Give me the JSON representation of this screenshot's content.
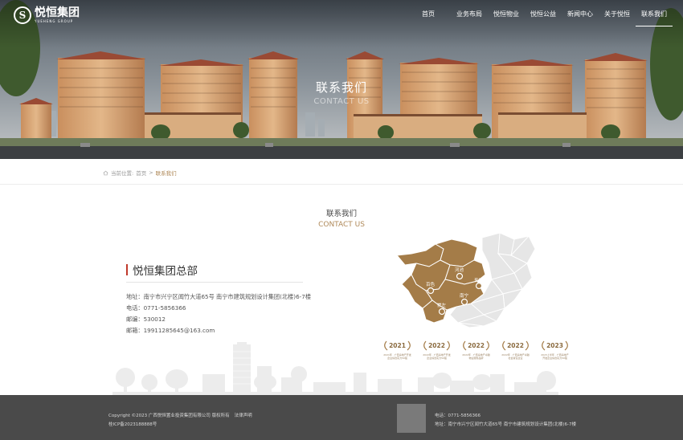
{
  "brand": {
    "logo_mark": "S",
    "name": "悦恒集团",
    "tagline": "YUEHENG GROUP"
  },
  "nav": {
    "items": [
      {
        "label": "首页"
      },
      {
        "label": "业务布局"
      },
      {
        "label": "悦恒物业"
      },
      {
        "label": "悦恒公益"
      },
      {
        "label": "新闻中心"
      },
      {
        "label": "关于悦恒"
      },
      {
        "label": "联系我们",
        "active": true
      }
    ]
  },
  "hero": {
    "title": "联系我们",
    "subtitle": "CONTACT US"
  },
  "breadcrumb": {
    "icon": "home-icon",
    "prefix": "当前位置:",
    "home": "首页",
    "separator": ">",
    "current": "联系我们"
  },
  "section": {
    "title": "联系我们",
    "subtitle": "CONTACT US"
  },
  "headquarters": {
    "title": "悦恒集团总部",
    "address": "地址：南宁市兴宁区闻竹大道65号 南宁市建筑规划设计集团(北楼)6-7楼",
    "phone": "电话：0771-5856366",
    "postcode": "邮编：530012",
    "email": "邮箱：19911285645@163.com"
  },
  "map": {
    "region_color": "#a47c48",
    "other_color": "#e8e8e8",
    "cities": [
      {
        "name": "河池"
      },
      {
        "name": "来宾"
      },
      {
        "name": "百色"
      },
      {
        "name": "南宁"
      },
      {
        "name": "崇左"
      }
    ]
  },
  "awards": [
    {
      "year": "2021",
      "text": "2021年 · 广西房地产开发企业综合实力50强"
    },
    {
      "year": "2022",
      "text": "2022年 · 广西房地产开发企业综合实力50强"
    },
    {
      "year": "2022",
      "text": "2022年 · 广西房地产卓越物业服务品牌"
    },
    {
      "year": "2022",
      "text": "2022年 · 广西房地产卓越社会责任企业"
    },
    {
      "year": "2023",
      "text": "2023上半年 · 广西房地产开发企业综合实力50强"
    }
  ],
  "footer": {
    "copyright": "Copyright ©2023 广西悦恒置业投资集团有限公司 版权所有",
    "legal_link": "法律声明",
    "icp": "桂ICP备2023188888号",
    "phone": "电话：0771-5856366",
    "address": "地址：南宁市兴宁区闻竹大道65号 南宁市建筑规划设计集团(北楼)6-7楼"
  }
}
